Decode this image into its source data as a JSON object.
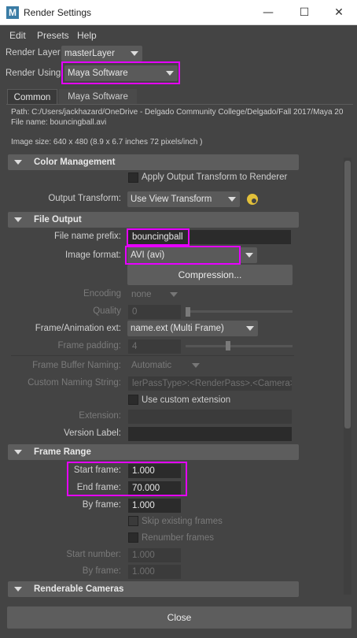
{
  "window": {
    "title": "Render Settings",
    "app_icon_letter": "M",
    "minimize": "—",
    "maximize": "☐",
    "close": "✕"
  },
  "menu": {
    "items": [
      "Edit",
      "Presets",
      "Help"
    ]
  },
  "render_layer": {
    "label": "Render Layer",
    "value": "masterLayer"
  },
  "render_using": {
    "label": "Render Using",
    "value": "Maya Software"
  },
  "tabs": [
    "Common",
    "Maya Software"
  ],
  "info": {
    "path": "Path: C:/Users/jackhazard/OneDrive - Delgado Community College/Delgado/Fall 2017/Maya 20",
    "file_name": "File name:  bouncingball.avi",
    "image_size": "Image size: 640 x 480 (8.9 x 6.7 inches 72 pixels/inch )"
  },
  "color_management": {
    "header": "Color Management",
    "apply_transform_label": "Apply Output Transform to Renderer",
    "output_transform_label": "Output Transform:",
    "output_transform_value": "Use View Transform"
  },
  "file_output": {
    "header": "File Output",
    "prefix_label": "File name prefix:",
    "prefix_value": "bouncingball",
    "format_label": "Image format:",
    "format_value": "AVI (avi)",
    "compression_button": "Compression...",
    "encoding_label": "Encoding",
    "encoding_value": "none",
    "quality_label": "Quality",
    "quality_value": "0",
    "frame_ext_label": "Frame/Animation ext:",
    "frame_ext_value": "name.ext (Multi Frame)",
    "frame_padding_label": "Frame padding:",
    "frame_padding_value": "4",
    "buffer_naming_label": "Frame Buffer Naming:",
    "buffer_naming_value": "Automatic",
    "custom_naming_label": "Custom Naming String:",
    "custom_naming_value": "lerPassType>:<RenderPass>.<Camera>",
    "use_custom_ext_label": "Use custom extension",
    "extension_label": "Extension:",
    "extension_value": "",
    "version_label": "Version Label:",
    "version_value": ""
  },
  "frame_range": {
    "header": "Frame Range",
    "start_label": "Start frame:",
    "start_value": "1.000",
    "end_label": "End frame:",
    "end_value": "70.000",
    "by_label": "By frame:",
    "by_value": "1.000",
    "skip_label": "Skip existing frames",
    "renumber_label": "Renumber frames",
    "start_number_label": "Start number:",
    "start_number_value": "1.000",
    "by_frame2_label": "By frame:",
    "by_frame2_value": "1.000"
  },
  "renderable_cameras": {
    "header": "Renderable Cameras"
  },
  "footer": {
    "close_button": "Close"
  },
  "colors": {
    "highlight": "#e600ff",
    "background": "#444444",
    "gear": "#e2c03a"
  }
}
